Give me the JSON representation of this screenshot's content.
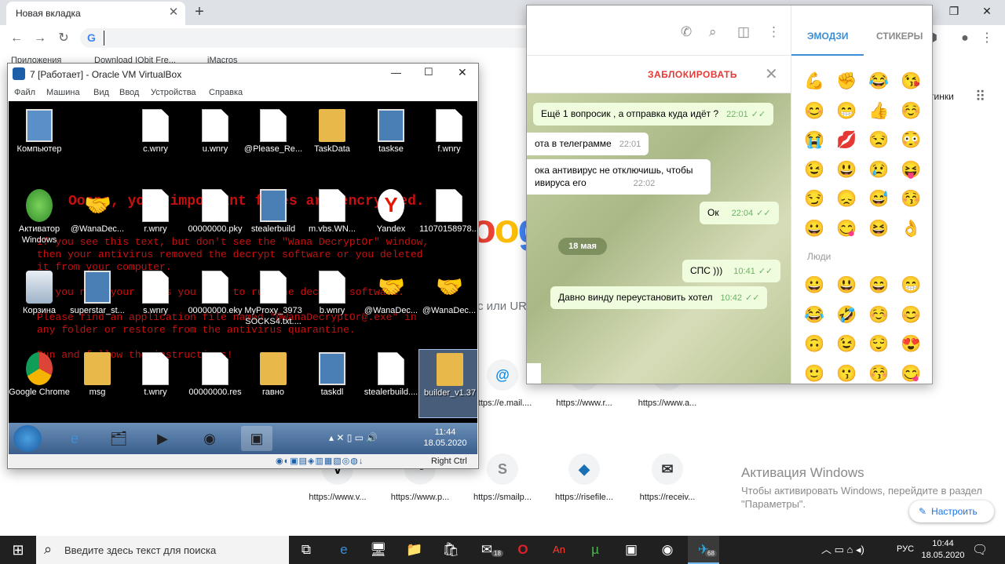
{
  "chrome": {
    "tab_title": "Новая вкладка",
    "tab_close": "✕",
    "newtab": "+",
    "back": "←",
    "forward": "→",
    "reload": "↻",
    "omnibox_value": "",
    "bookmarks": [
      "Приложения",
      "Download IObit Fre...",
      "iMacros"
    ],
    "gmail_fragment": "тинки",
    "search_fragment": "с или URL",
    "tiles_row1": [
      "https://e.mail....",
      "https://www.r...",
      "https://www.a..."
    ],
    "tiles_row2": [
      "https://www.v...",
      "https://www.p...",
      "https://smailp...",
      "https://risefile...",
      "https://receiv..."
    ],
    "activation_title": "Активация Windows",
    "activation_text": "Чтобы активировать Windows, перейдите в раздел \"Параметры\".",
    "customize": "Настроить"
  },
  "vbox": {
    "title": "7 [Работает] - Oracle VM VirtualBox",
    "menu": [
      "Файл",
      "Машина",
      "Вид",
      "Ввод",
      "Устройства",
      "Справка"
    ],
    "wana_lines": [
      "Ooops, your important files are encrypted.",
      "If you see this text, but don't see the \"Wana DecryptOr\" window,",
      "then your antivirus removed the decrypt software or you deleted",
      "it from your computer.",
      "If you need your files you have to run the decrypt software.",
      "Please find an application file named \"@WanaDecryptOr@.exe\" in",
      "any folder or restore from the antivirus quarantine.",
      "Run and follow the instructions!"
    ],
    "icons": [
      "Компьютер",
      "c.wnry",
      "u.wnry",
      "@Please_Re...",
      "TaskData",
      "taskse",
      "f.wnry",
      "Активатор Windows",
      "@WanaDec...",
      "r.wnry",
      "00000000.pky",
      "stealerbuild",
      "m.vbs.WN...",
      "Yandex",
      "11070158978...",
      "Корзина",
      "superstar_st...",
      "s.wnry",
      "00000000.eky",
      "MyProxy_3973 SOCKS4.txt....",
      "b.wnry",
      "@WanaDec...",
      "@WanaDec...",
      "Google Chrome",
      "msg",
      "t.wnry",
      "00000000.res",
      "гавно",
      "taskdl",
      "stealerbuild....",
      "builder_v1.37"
    ],
    "clock_time": "11:44",
    "clock_date": "18.05.2020",
    "right_ctrl": "Right Ctrl"
  },
  "telegram": {
    "block": "ЗАБЛОКИРОВАТЬ",
    "tab_emoji": "ЭМОДЗИ",
    "tab_stickers": "СТИКЕРЫ",
    "date_pill": "18 мая",
    "people_label": "Люди",
    "messages": [
      {
        "text": "Ещё 1 вопросик , а отправка куда идёт ?",
        "time": "22:01",
        "dir": "out"
      },
      {
        "text": "ота в телеграмме",
        "time": "22:01",
        "dir": "in"
      },
      {
        "text": "ока антивирус не отключишь, чтобы",
        "time": "",
        "dir": "in"
      },
      {
        "text": "ивируса его",
        "time": "22:02",
        "dir": "in"
      },
      {
        "text": "Ок",
        "time": "22:04",
        "dir": "out"
      },
      {
        "text": "СПС )))",
        "time": "10:41",
        "dir": "out"
      },
      {
        "text": "Давно винду переустановить хотел",
        "time": "10:42",
        "dir": "out"
      }
    ],
    "emojis": [
      "💪",
      "✊",
      "😂",
      "😘",
      "😊",
      "😁",
      "👍",
      "☺️",
      "😭",
      "💋",
      "😒",
      "😳",
      "😉",
      "😃",
      "😢",
      "😝",
      "😏",
      "😞",
      "😅",
      "😚",
      "😀",
      "😋",
      "😆",
      "👌",
      "😀",
      "😃",
      "😄",
      "😁",
      "😂",
      "🤣",
      "☺️",
      "😊",
      "🙃",
      "😉",
      "😌",
      "😍",
      "🙂",
      "😗",
      "😚",
      "😋"
    ]
  },
  "taskbar": {
    "search_placeholder": "Введите здесь текст для поиска",
    "lang": "РУС",
    "time": "10:44",
    "date": "18.05.2020",
    "badge_mail": "18",
    "badge_tg": "68"
  }
}
